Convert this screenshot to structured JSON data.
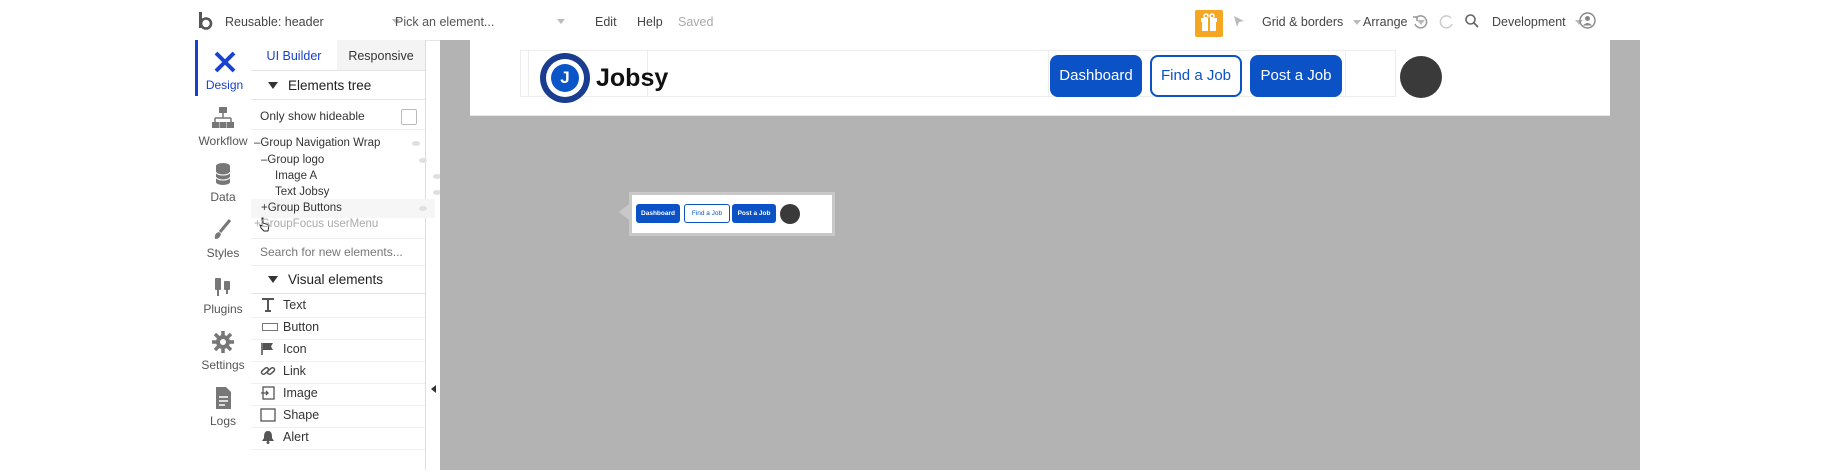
{
  "topbar": {
    "page_selector": "Reusable: header",
    "element_picker_placeholder": "Pick an element...",
    "edit_label": "Edit",
    "help_label": "Help",
    "saved_label": "Saved",
    "grid_label": "Grid & borders",
    "arrange_label": "Arrange",
    "environment_label": "Development"
  },
  "rail": {
    "items": [
      {
        "label": "Design",
        "icon": "design-icon"
      },
      {
        "label": "Workflow",
        "icon": "workflow-icon"
      },
      {
        "label": "Data",
        "icon": "database-icon"
      },
      {
        "label": "Styles",
        "icon": "brush-icon"
      },
      {
        "label": "Plugins",
        "icon": "plug-icon"
      },
      {
        "label": "Settings",
        "icon": "gear-icon"
      },
      {
        "label": "Logs",
        "icon": "document-icon"
      }
    ]
  },
  "panel": {
    "tabs": [
      "UI Builder",
      "Responsive"
    ],
    "elements_tree_title": "Elements tree",
    "only_hideable_label": "Only show hideable",
    "tree": [
      {
        "label": "Group Navigation Wrap",
        "prefix": "–"
      },
      {
        "label": "Group logo",
        "prefix": "–"
      },
      {
        "label": "Image A",
        "prefix": ""
      },
      {
        "label": "Text Jobsy",
        "prefix": ""
      },
      {
        "label": "Group Buttons",
        "prefix": "+"
      },
      {
        "label": "GroupFocus userMenu",
        "prefix": "+"
      }
    ],
    "search_placeholder": "Search for new elements...",
    "visual_elements_title": "Visual elements",
    "visual_elements": [
      {
        "label": "Text",
        "icon": "text-icon"
      },
      {
        "label": "Button",
        "icon": "button-icon"
      },
      {
        "label": "Icon",
        "icon": "flag-icon"
      },
      {
        "label": "Link",
        "icon": "link-icon"
      },
      {
        "label": "Image",
        "icon": "image-icon"
      },
      {
        "label": "Shape",
        "icon": "shape-icon"
      },
      {
        "label": "Alert",
        "icon": "bell-icon"
      }
    ]
  },
  "canvas": {
    "logo_letter": "J",
    "brand_text": "Jobsy",
    "buttons": [
      "Dashboard",
      "Find a Job",
      "Post a Job"
    ]
  },
  "preview": {
    "buttons": [
      "Dashboard",
      "Find a Job",
      "Post a Job"
    ]
  },
  "colors": {
    "accent": "#1940d0",
    "brand_blue": "#0a52c6",
    "canvas_gray": "#b3b3b3",
    "gift_orange": "#f5a623"
  }
}
